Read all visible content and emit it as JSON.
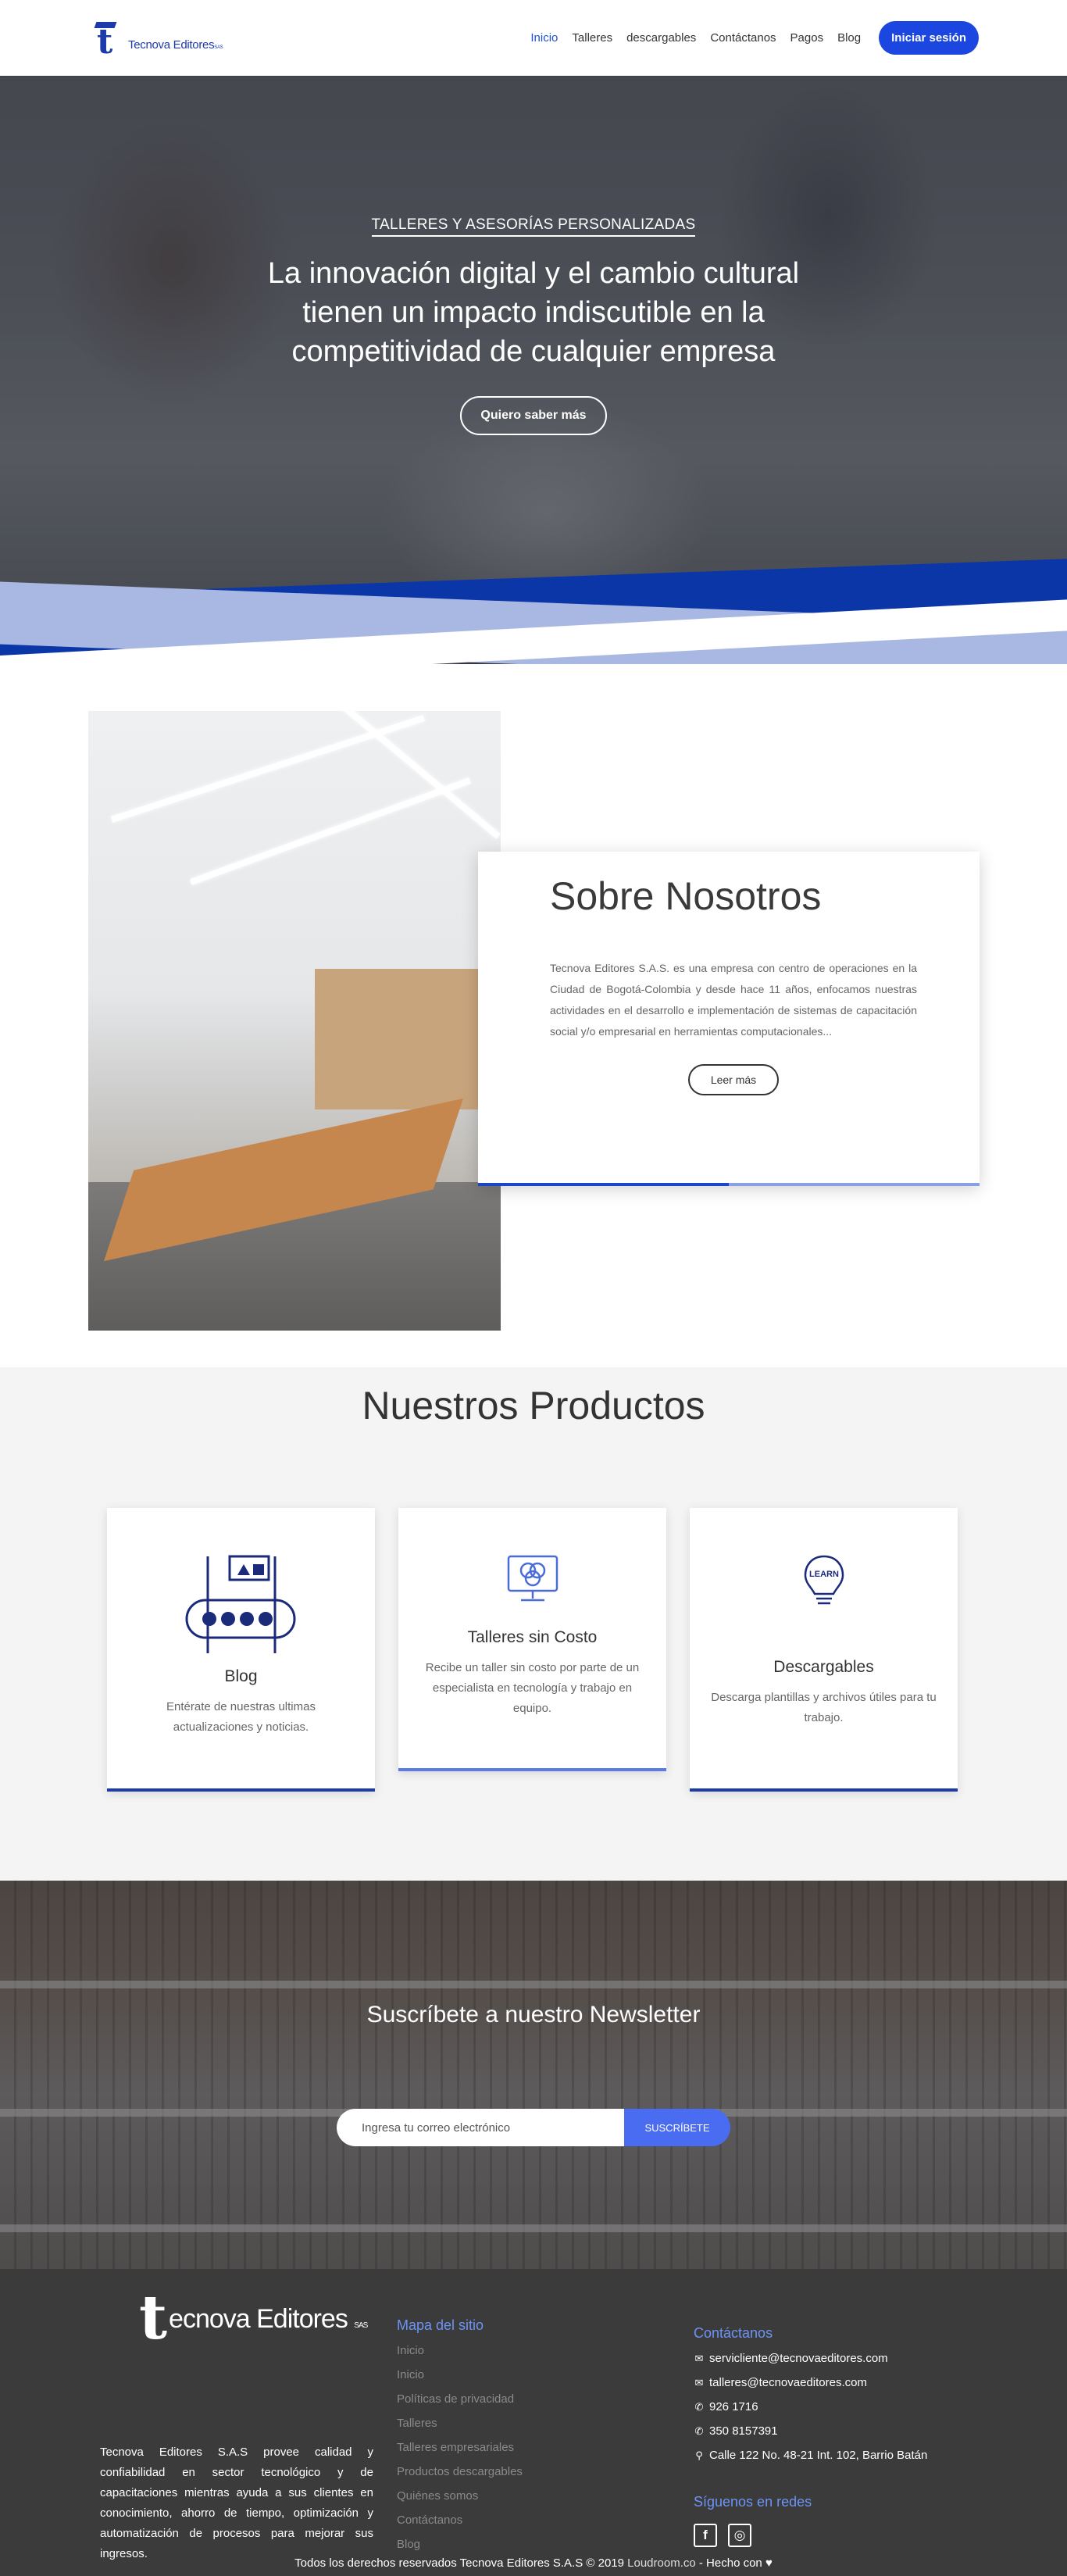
{
  "header": {
    "logo_text": "Tecnova Editores",
    "logo_suffix": "SAS",
    "nav": [
      {
        "label": "Inicio",
        "active": true
      },
      {
        "label": "Talleres"
      },
      {
        "label": "descargables"
      },
      {
        "label": "Contáctanos"
      },
      {
        "label": "Pagos"
      },
      {
        "label": "Blog"
      }
    ],
    "login_label": "Iniciar sesión"
  },
  "hero": {
    "kicker": "TALLERES Y ASESORÍAS PERSONALIZADAS",
    "title": "La innovación digital y el cambio cultural tienen un impacto indiscutible en la competitividad de cualquier empresa",
    "button": "Quiero saber más"
  },
  "about": {
    "title": "Sobre Nosotros",
    "text": "Tecnova Editores S.A.S. es una empresa con centro de operaciones en la Ciudad de Bogotá-Colombia y desde hace 11 años, enfocamos nuestras actividades en el desarrollo e implementación de sistemas de capacitación social y/o empresarial en herramientas computacionales...",
    "button": "Leer más"
  },
  "products": {
    "title": "Nuestros Productos",
    "cards": [
      {
        "title": "Blog",
        "text": "Entérate de nuestras ultimas actualizaciones y noticias.",
        "icon": "presentation-board-icon"
      },
      {
        "title": "Talleres sin Costo",
        "text": "Recibe un taller sin costo por parte de un especialista en tecnología y trabajo en equipo.",
        "icon": "monitor-venn-icon"
      },
      {
        "title": "Descargables",
        "text": "Descarga plantillas y archivos útiles para tu trabajo.",
        "icon": "learn-lightbulb-icon"
      }
    ]
  },
  "newsletter": {
    "title": "Suscríbete a nuestro Newsletter",
    "placeholder": "Ingresa tu correo electrónico",
    "button": "SUSCRÍBETE"
  },
  "footer": {
    "logo_text": "ecnova Editores",
    "logo_suffix": "SAS",
    "description": "Tecnova Editores S.A.S provee calidad y confiabilidad en sector tecnológico y de capacitaciones mientras ayuda a sus clientes en conocimiento, ahorro de tiempo, optimización y automatización de procesos para mejorar sus ingresos.",
    "sitemap_title": "Mapa del sitio",
    "sitemap": [
      "Inicio",
      "Inicio",
      "Políticas de privacidad",
      "Talleres",
      "Talleres empresariales",
      "Productos descargables",
      "Quiénes somos",
      "Contáctanos",
      "Blog"
    ],
    "contact_title": "Contáctanos",
    "contact": [
      {
        "icon": "envelope-icon",
        "text": "servicliente@tecnovaeditores.com"
      },
      {
        "icon": "envelope-icon",
        "text": "talleres@tecnovaeditores.com"
      },
      {
        "icon": "phone-icon",
        "text": "926 1716"
      },
      {
        "icon": "phone-icon",
        "text": "350 8157391"
      },
      {
        "icon": "map-pin-icon",
        "text": "Calle 122 No. 48-21 Int. 102, Barrio Batán"
      }
    ],
    "social_title": "Síguenos en redes",
    "copyright_prefix": "Todos los derechos reservados Tecnova Editores S.A.S © 2019 ",
    "copyright_brand": "Loudroom.co",
    "copyright_suffix": " - Hecho con "
  },
  "colors": {
    "accent": "#1c46e0",
    "brand_blue": "#1c3aa9",
    "footer_bg": "#3b3b3b",
    "footer_heading": "#6d93f5"
  }
}
